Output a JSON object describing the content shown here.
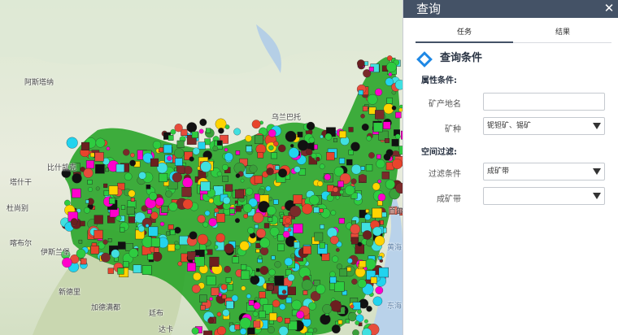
{
  "panel": {
    "title": "查询",
    "close_icon": "✕",
    "tabs": [
      {
        "label": "任务",
        "active": true
      },
      {
        "label": "结果",
        "active": false
      }
    ],
    "section_title": "查询条件",
    "attribute_heading": "属性条件:",
    "spatial_heading": "空间过滤:",
    "fields": {
      "mine_name": {
        "label": "矿产地名",
        "value": "",
        "placeholder": ""
      },
      "mineral": {
        "label": "矿种",
        "value": "铌钽矿、锡矿"
      },
      "filter": {
        "label": "过滤条件",
        "value": "成矿带"
      },
      "belt": {
        "label": "成矿带",
        "value": ""
      }
    },
    "accent_color": "#1e88e5",
    "header_color": "#445266"
  },
  "map": {
    "labels": [
      {
        "text": "阿斯塔纳"
      },
      {
        "text": "乌兰巴托"
      },
      {
        "text": "比什凯克"
      },
      {
        "text": "塔什干"
      },
      {
        "text": "杜尚别"
      },
      {
        "text": "喀布尔"
      },
      {
        "text": "伊斯兰堡"
      },
      {
        "text": "新德里"
      },
      {
        "text": "加德满都"
      },
      {
        "text": "廷布"
      },
      {
        "text": "达卡"
      },
      {
        "text": "黄海"
      },
      {
        "text": "东海"
      },
      {
        "text": "首尔"
      }
    ]
  }
}
